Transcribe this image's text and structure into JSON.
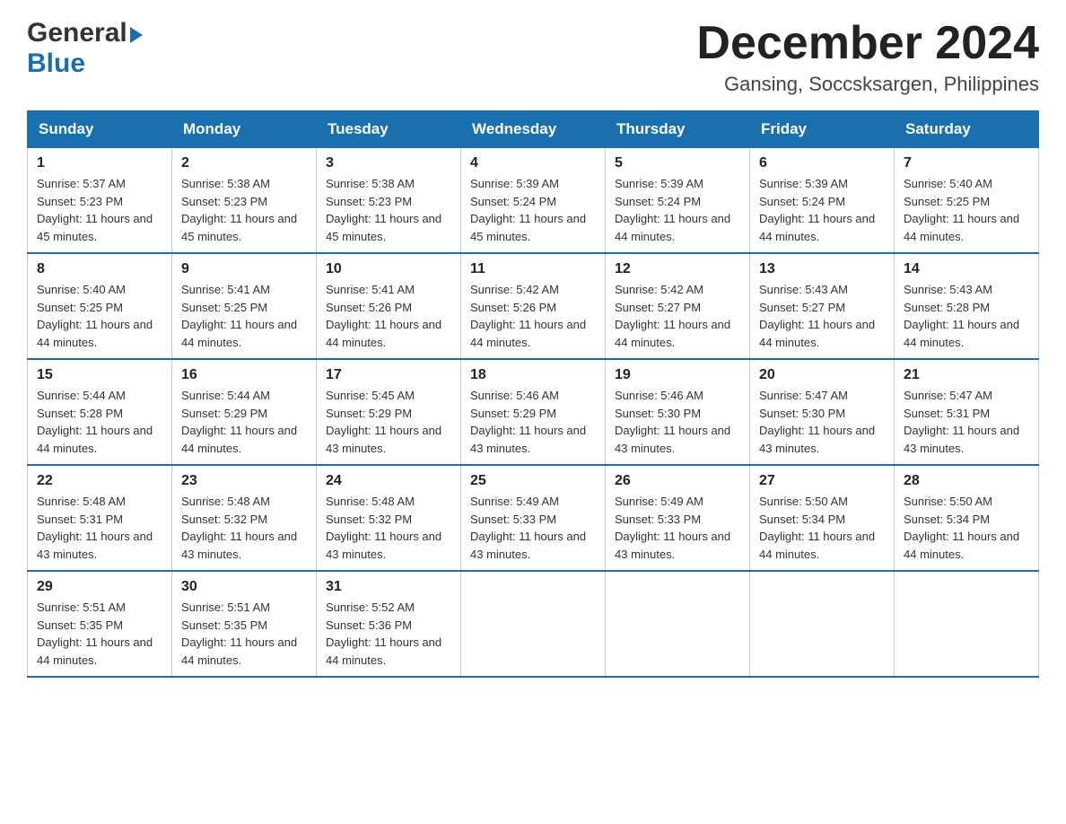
{
  "header": {
    "logo_general": "General",
    "logo_blue": "Blue",
    "month_title": "December 2024",
    "location": "Gansing, Soccsksargen, Philippines"
  },
  "days_of_week": [
    "Sunday",
    "Monday",
    "Tuesday",
    "Wednesday",
    "Thursday",
    "Friday",
    "Saturday"
  ],
  "weeks": [
    [
      {
        "day": "1",
        "sunrise": "5:37 AM",
        "sunset": "5:23 PM",
        "daylight": "11 hours and 45 minutes."
      },
      {
        "day": "2",
        "sunrise": "5:38 AM",
        "sunset": "5:23 PM",
        "daylight": "11 hours and 45 minutes."
      },
      {
        "day": "3",
        "sunrise": "5:38 AM",
        "sunset": "5:23 PM",
        "daylight": "11 hours and 45 minutes."
      },
      {
        "day": "4",
        "sunrise": "5:39 AM",
        "sunset": "5:24 PM",
        "daylight": "11 hours and 45 minutes."
      },
      {
        "day": "5",
        "sunrise": "5:39 AM",
        "sunset": "5:24 PM",
        "daylight": "11 hours and 44 minutes."
      },
      {
        "day": "6",
        "sunrise": "5:39 AM",
        "sunset": "5:24 PM",
        "daylight": "11 hours and 44 minutes."
      },
      {
        "day": "7",
        "sunrise": "5:40 AM",
        "sunset": "5:25 PM",
        "daylight": "11 hours and 44 minutes."
      }
    ],
    [
      {
        "day": "8",
        "sunrise": "5:40 AM",
        "sunset": "5:25 PM",
        "daylight": "11 hours and 44 minutes."
      },
      {
        "day": "9",
        "sunrise": "5:41 AM",
        "sunset": "5:25 PM",
        "daylight": "11 hours and 44 minutes."
      },
      {
        "day": "10",
        "sunrise": "5:41 AM",
        "sunset": "5:26 PM",
        "daylight": "11 hours and 44 minutes."
      },
      {
        "day": "11",
        "sunrise": "5:42 AM",
        "sunset": "5:26 PM",
        "daylight": "11 hours and 44 minutes."
      },
      {
        "day": "12",
        "sunrise": "5:42 AM",
        "sunset": "5:27 PM",
        "daylight": "11 hours and 44 minutes."
      },
      {
        "day": "13",
        "sunrise": "5:43 AM",
        "sunset": "5:27 PM",
        "daylight": "11 hours and 44 minutes."
      },
      {
        "day": "14",
        "sunrise": "5:43 AM",
        "sunset": "5:28 PM",
        "daylight": "11 hours and 44 minutes."
      }
    ],
    [
      {
        "day": "15",
        "sunrise": "5:44 AM",
        "sunset": "5:28 PM",
        "daylight": "11 hours and 44 minutes."
      },
      {
        "day": "16",
        "sunrise": "5:44 AM",
        "sunset": "5:29 PM",
        "daylight": "11 hours and 44 minutes."
      },
      {
        "day": "17",
        "sunrise": "5:45 AM",
        "sunset": "5:29 PM",
        "daylight": "11 hours and 43 minutes."
      },
      {
        "day": "18",
        "sunrise": "5:46 AM",
        "sunset": "5:29 PM",
        "daylight": "11 hours and 43 minutes."
      },
      {
        "day": "19",
        "sunrise": "5:46 AM",
        "sunset": "5:30 PM",
        "daylight": "11 hours and 43 minutes."
      },
      {
        "day": "20",
        "sunrise": "5:47 AM",
        "sunset": "5:30 PM",
        "daylight": "11 hours and 43 minutes."
      },
      {
        "day": "21",
        "sunrise": "5:47 AM",
        "sunset": "5:31 PM",
        "daylight": "11 hours and 43 minutes."
      }
    ],
    [
      {
        "day": "22",
        "sunrise": "5:48 AM",
        "sunset": "5:31 PM",
        "daylight": "11 hours and 43 minutes."
      },
      {
        "day": "23",
        "sunrise": "5:48 AM",
        "sunset": "5:32 PM",
        "daylight": "11 hours and 43 minutes."
      },
      {
        "day": "24",
        "sunrise": "5:48 AM",
        "sunset": "5:32 PM",
        "daylight": "11 hours and 43 minutes."
      },
      {
        "day": "25",
        "sunrise": "5:49 AM",
        "sunset": "5:33 PM",
        "daylight": "11 hours and 43 minutes."
      },
      {
        "day": "26",
        "sunrise": "5:49 AM",
        "sunset": "5:33 PM",
        "daylight": "11 hours and 43 minutes."
      },
      {
        "day": "27",
        "sunrise": "5:50 AM",
        "sunset": "5:34 PM",
        "daylight": "11 hours and 44 minutes."
      },
      {
        "day": "28",
        "sunrise": "5:50 AM",
        "sunset": "5:34 PM",
        "daylight": "11 hours and 44 minutes."
      }
    ],
    [
      {
        "day": "29",
        "sunrise": "5:51 AM",
        "sunset": "5:35 PM",
        "daylight": "11 hours and 44 minutes."
      },
      {
        "day": "30",
        "sunrise": "5:51 AM",
        "sunset": "5:35 PM",
        "daylight": "11 hours and 44 minutes."
      },
      {
        "day": "31",
        "sunrise": "5:52 AM",
        "sunset": "5:36 PM",
        "daylight": "11 hours and 44 minutes."
      },
      null,
      null,
      null,
      null
    ]
  ],
  "labels": {
    "sunrise": "Sunrise:",
    "sunset": "Sunset:",
    "daylight": "Daylight:"
  }
}
